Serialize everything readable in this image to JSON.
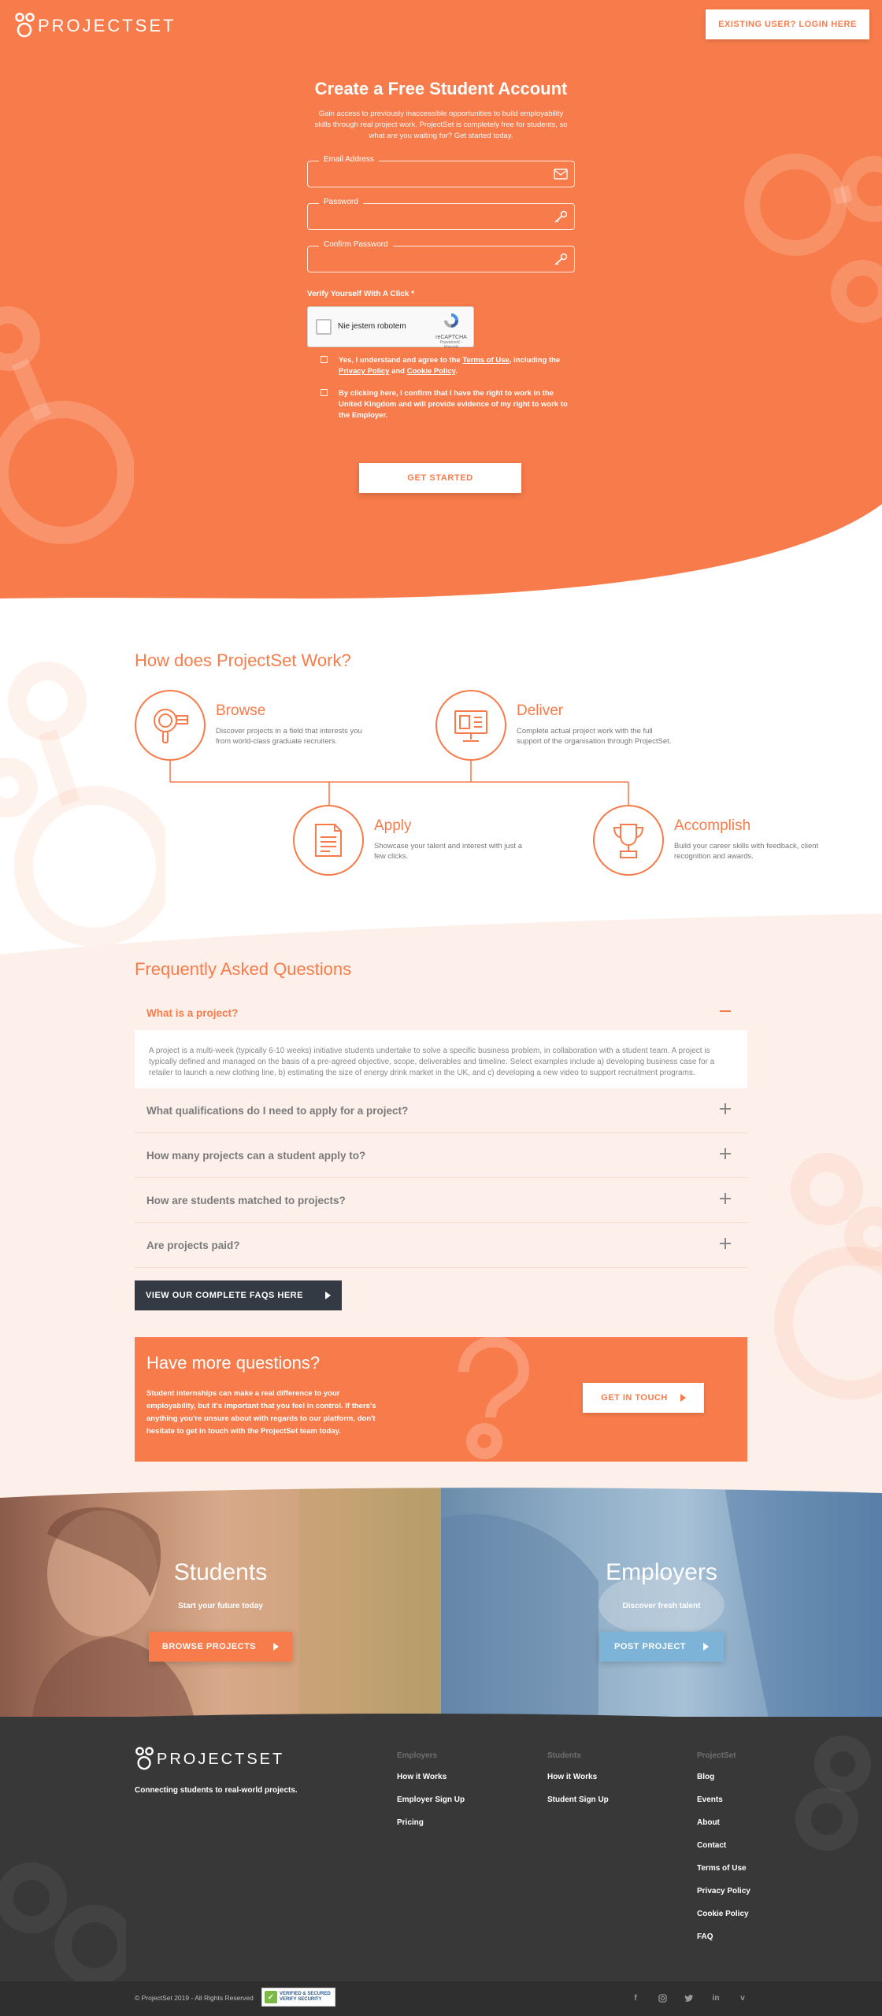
{
  "header": {
    "logo_text": "PROJECTSET",
    "login_label": "EXISTING USER? LOGIN HERE"
  },
  "signup": {
    "title": "Create a Free Student Account",
    "subtitle": "Gain access to previously inaccessible opportunities to build employability skills through real project work. ProjectSet is completely free for students, so what are you waiting for? Get started today.",
    "email_label": "Email Address",
    "password_label": "Password",
    "confirm_label": "Confirm Password",
    "verify_label": "Verify Yourself With A Click *",
    "captcha_text": "Nie jestem robotem",
    "captcha_brand": "reCAPTCHA",
    "captcha_terms": "Prywatność - Warunki",
    "terms_prefix": "Yes, I understand and agree to the ",
    "terms_link": "Terms of Use",
    "terms_mid": ", including the ",
    "privacy_link": "Privacy Policy",
    "and_text": " and ",
    "cookie_link": "Cookie Policy",
    "terms_end": ".",
    "right_to_work": "By clicking here, I confirm that I have the right to work in the United Kingdom and will provide evidence of my right to work to the Employer.",
    "submit_label": "GET STARTED"
  },
  "how": {
    "title": "How does ProjectSet Work?",
    "steps": [
      {
        "name": "Browse",
        "desc": "Discover projects in a field that interests you from world-class graduate recruiters.",
        "icon": "magnifier-icon"
      },
      {
        "name": "Deliver",
        "desc": "Complete actual project work with the full support of the organisation through ProjectSet.",
        "icon": "monitor-icon"
      },
      {
        "name": "Apply",
        "desc": "Showcase your talent and interest with just a few clicks.",
        "icon": "document-icon"
      },
      {
        "name": "Accomplish",
        "desc": "Build your career skills with feedback, client recognition and awards.",
        "icon": "trophy-icon"
      }
    ]
  },
  "faq": {
    "title": "Frequently Asked Questions",
    "items": [
      {
        "q": "What is a project?",
        "a": "A project is a multi-week (typically 6-10 weeks) initiative students undertake to solve a specific business problem, in collaboration with a student team. A project is typically defined and managed on the basis of a pre-agreed objective, scope, deliverables and timeline. Select examples include a) developing business case for a retailer to launch a new clothing line, b) estimating the size of energy drink market in the UK, and c) developing a new video to support recruitment programs."
      },
      {
        "q": "What qualifications do I need to apply for a project?"
      },
      {
        "q": "How many projects can a student apply to?"
      },
      {
        "q": "How are students matched to projects?"
      },
      {
        "q": "Are projects paid?"
      }
    ],
    "all_label": "VIEW OUR COMPLETE FAQS HERE"
  },
  "more": {
    "title": "Have more questions?",
    "text": "Student internships can make a real difference to your employability, but it's important that you feel in control. If there's anything you're unsure about with regards to our platform, don't hesitate to get in touch with the ProjectSet team today.",
    "button": "GET IN TOUCH"
  },
  "split": {
    "students": {
      "title": "Students",
      "sub": "Start your future today",
      "button": "BROWSE PROJECTS"
    },
    "employers": {
      "title": "Employers",
      "sub": "Discover fresh talent",
      "button": "POST PROJECT"
    }
  },
  "footer": {
    "logo_text": "PROJECTSET",
    "tagline": "Connecting students to real-world projects.",
    "columns": [
      {
        "head": "Employers",
        "links": [
          "How it Works",
          "Employer Sign Up",
          "Pricing"
        ]
      },
      {
        "head": "Students",
        "links": [
          "How it Works",
          "Student Sign Up"
        ]
      },
      {
        "head": "ProjectSet",
        "links": [
          "Blog",
          "Events",
          "About",
          "Contact",
          "Terms of Use",
          "Privacy Policy",
          "Cookie Policy",
          "FAQ"
        ]
      }
    ],
    "copyright": "© ProjectSet 2019 - All Rights Reserved",
    "badge": "VERIFIED & SECURED",
    "badge_sub": "VERIFY SECURITY",
    "socials": [
      "facebook-icon",
      "instagram-icon",
      "twitter-icon",
      "linkedin-icon",
      "vimeo-icon"
    ]
  },
  "colors": {
    "accent": "#f87c4b",
    "dark": "#343a44",
    "footer": "#383838",
    "faq_bg": "#fdf0ea",
    "employer_btn": "#7cb3d6"
  }
}
